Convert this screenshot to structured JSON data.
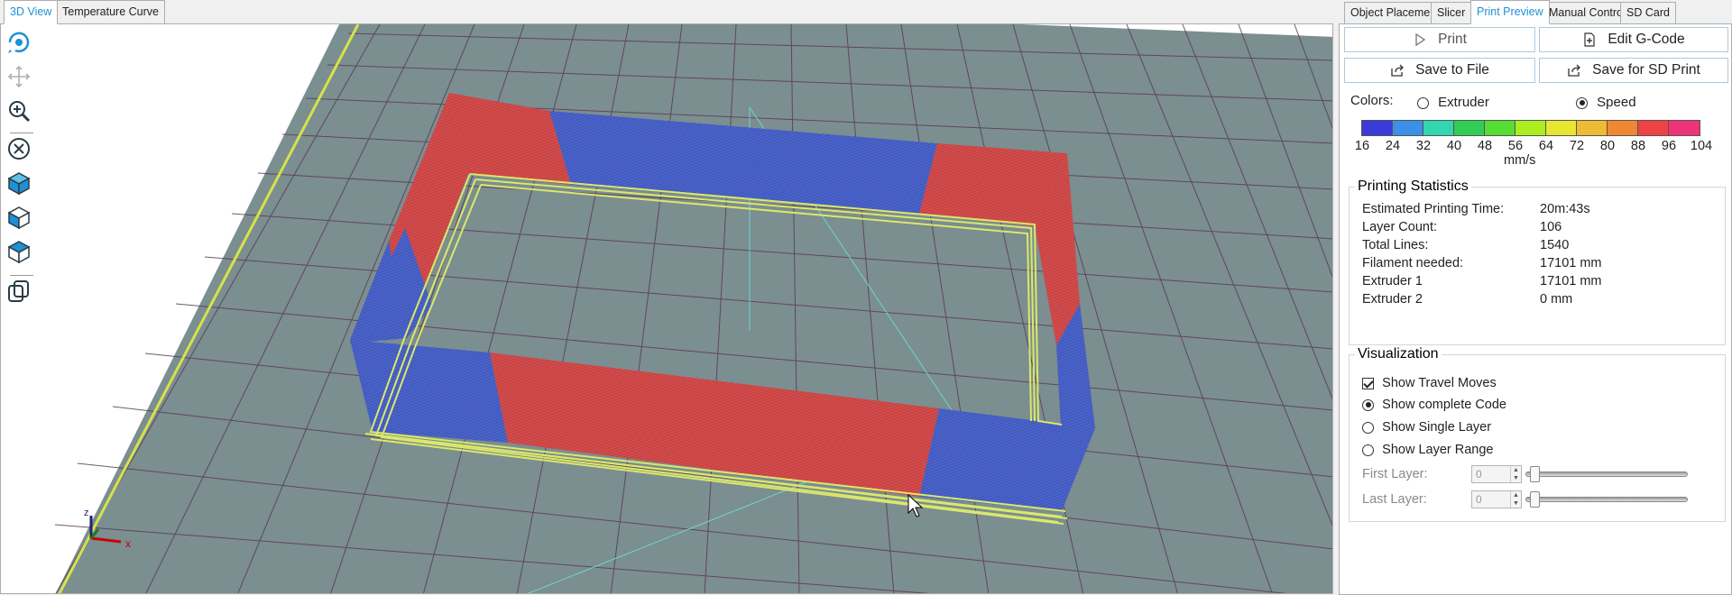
{
  "left_tabs": [
    {
      "label": "3D View",
      "active": true
    },
    {
      "label": "Temperature Curve",
      "active": false
    }
  ],
  "toolbar_icons": [
    "rotate-view-icon",
    "move-view-icon",
    "zoom-icon",
    "fit-view-icon",
    "isometric-view-icon",
    "front-view-icon",
    "top-view-icon",
    "layers-toggle-icon"
  ],
  "axes": {
    "x": "x",
    "z": "z"
  },
  "right_tabs": [
    {
      "label": "Object Placement",
      "active": false
    },
    {
      "label": "Slicer",
      "active": false
    },
    {
      "label": "Print Preview",
      "active": true
    },
    {
      "label": "Manual Control",
      "active": false
    },
    {
      "label": "SD Card",
      "active": false
    }
  ],
  "buttons": {
    "print": "Print",
    "edit_gcode": "Edit G-Code",
    "save_to_file": "Save to File",
    "save_sd": "Save for SD Print"
  },
  "colors_section": {
    "label": "Colors:",
    "options": [
      {
        "label": "Extruder",
        "checked": false
      },
      {
        "label": "Speed",
        "checked": true
      }
    ],
    "scale_colors": [
      "#3b3bd9",
      "#3d8fe8",
      "#33d6b0",
      "#33cc55",
      "#55dd33",
      "#aaee22",
      "#e6e633",
      "#eebb33",
      "#ee8833",
      "#ee4444",
      "#ee3377"
    ],
    "scale_values": [
      "16",
      "24",
      "32",
      "40",
      "48",
      "56",
      "64",
      "72",
      "80",
      "88",
      "96",
      "104"
    ],
    "unit": "mm/s"
  },
  "stats": {
    "title": "Printing Statistics",
    "rows": [
      {
        "label": "Estimated Printing Time:",
        "value": "20m:43s"
      },
      {
        "label": "Layer Count:",
        "value": "106"
      },
      {
        "label": "Total Lines:",
        "value": "1540"
      },
      {
        "label": "Filament needed:",
        "value": "17101 mm"
      },
      {
        "label": "Extruder 1",
        "value": "17101 mm"
      },
      {
        "label": "Extruder 2",
        "value": "0 mm"
      }
    ]
  },
  "visualization": {
    "title": "Visualization",
    "show_travel_moves": {
      "label": "Show Travel Moves",
      "checked": true
    },
    "modes": [
      {
        "label": "Show complete Code",
        "checked": true
      },
      {
        "label": "Show Single Layer",
        "checked": false
      },
      {
        "label": "Show Layer Range",
        "checked": false
      }
    ],
    "first_layer": {
      "label": "First Layer:",
      "value": "0"
    },
    "last_layer": {
      "label": "Last Layer:",
      "value": "0"
    }
  }
}
